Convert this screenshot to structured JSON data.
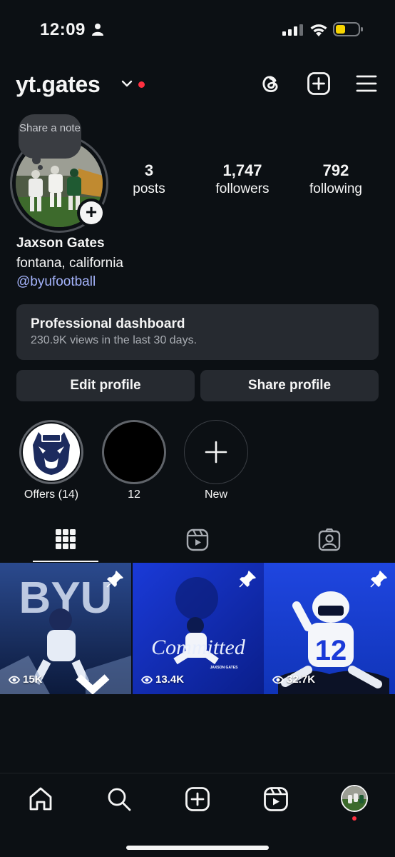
{
  "status_bar": {
    "time": "12:09",
    "colors": {
      "battery": "#f7d400"
    }
  },
  "header": {
    "username": "yt.gates",
    "icons": [
      "chevron-down-icon",
      "threads-icon",
      "create-icon",
      "menu-icon"
    ]
  },
  "profile": {
    "note_prompt": "Share a note",
    "stats": [
      {
        "value": "3",
        "label": "posts"
      },
      {
        "value": "1,747",
        "label": "followers"
      },
      {
        "value": "792",
        "label": "following"
      }
    ],
    "full_name": "Jaxson Gates",
    "location": "fontana, california",
    "link": "@byufootball"
  },
  "dashboard": {
    "title": "Professional dashboard",
    "subtitle": "230.9K views in the last 30 days."
  },
  "actions": {
    "edit_profile": "Edit profile",
    "share_profile": "Share profile"
  },
  "highlights": [
    {
      "label": "Offers (14)"
    },
    {
      "label": "12"
    },
    {
      "label": "New"
    }
  ],
  "tabs": [
    "grid-icon",
    "reels-icon",
    "tagged-icon"
  ],
  "posts": [
    {
      "views": "15K",
      "pinned": true
    },
    {
      "views": "13.4K",
      "pinned": true
    },
    {
      "views": "32.7K",
      "pinned": true
    }
  ],
  "post_texts": {
    "post1_overlay": "BYU",
    "post2_overlay": "Committed",
    "post2_name": "JAXSON GATES",
    "post3_jersey": "12"
  },
  "bottom_nav": [
    "home-icon",
    "search-icon",
    "create-icon",
    "reels-icon",
    "profile-avatar"
  ],
  "colors": {
    "background": "#0c1014",
    "surface": "#262a30",
    "link": "#a5b4fc",
    "notify": "#ff3040",
    "byu_blue": "#1a3ad8"
  }
}
